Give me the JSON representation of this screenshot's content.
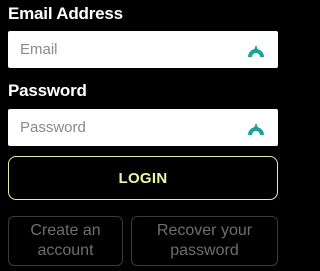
{
  "form": {
    "email_label": "Email Address",
    "email_placeholder": "Email",
    "password_label": "Password",
    "password_placeholder": "Password",
    "login_label": "LOGIN",
    "create_account_line1": "Create an",
    "create_account_line2": "account",
    "recover_password_line1": "Recover your",
    "recover_password_line2": "password"
  },
  "icons": {
    "field_icon": "password-manager-icon"
  },
  "colors": {
    "background": "#000000",
    "login_text": "#f0f6a8",
    "login_border": "#e8f0a0",
    "secondary_text": "#6e6e6e",
    "icon_teal": "#1aa39a"
  }
}
